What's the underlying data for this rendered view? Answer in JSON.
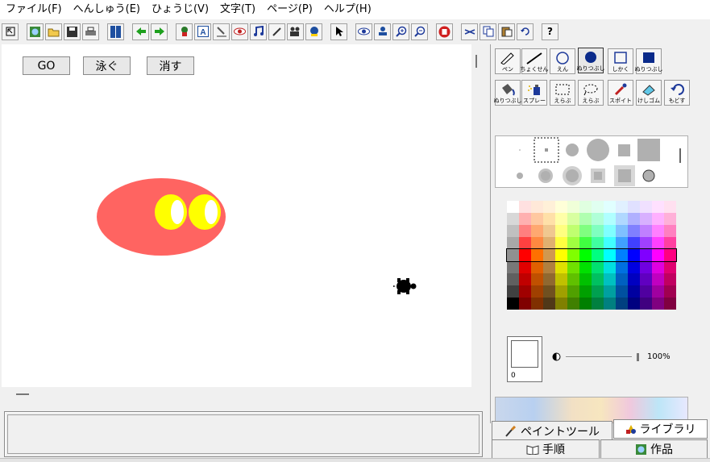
{
  "menu": [
    "ファイル(F)",
    "へんしゅう(E)",
    "ひょうじ(V)",
    "文字(T)",
    "ページ(P)",
    "ヘルプ(H)"
  ],
  "toolbar_icons": [
    "pointer-select-icon",
    "globe-icon",
    "open-folder-icon",
    "save-icon",
    "print-icon",
    "book-icon",
    "arrow-left-icon",
    "arrow-right-icon",
    "character-icon",
    "text-box-icon",
    "paint-tool-icon",
    "eye-icon",
    "music-icon",
    "pen-tool-icon",
    "camera-icon",
    "robot-icon",
    "arrow-cursor-icon",
    "view-eye-icon",
    "stamp-icon",
    "zoom-in-icon",
    "zoom-out-icon",
    "stop-hand-icon",
    "scissors-icon",
    "copy-icon",
    "paste-icon",
    "undo-icon",
    "help-icon"
  ],
  "help_label": "?",
  "canvas": {
    "buttons": [
      {
        "label": "GO"
      },
      {
        "label": "泳ぐ"
      },
      {
        "label": "消す"
      }
    ],
    "fish_color": "#ff6461",
    "eye_color": "#ffff00"
  },
  "paint_tools": {
    "row1": [
      "ペン",
      "ちょくせん",
      "えん",
      "ぬりつぶし",
      "しかく",
      "ぬりつぶし"
    ],
    "row2": [
      "ぬりつぶし",
      "スプレー",
      "えらぶ",
      "えらぶ",
      "スポイト",
      "けしゴム",
      "もどす"
    ]
  },
  "current_color": {
    "value": "0",
    "color": "#ffffff"
  },
  "opacity": {
    "label": "100%",
    "value": 100
  },
  "tabs": {
    "paint": "ペイントツール",
    "library": "ライブラリ",
    "steps": "手順",
    "works": "作品"
  },
  "palette_columns": [
    [
      "#ffffff",
      "#d8d8d8",
      "#c0c0c0",
      "#a8a8a8",
      "#909090",
      "#787878",
      "#606060",
      "#404040",
      "#000000"
    ],
    [
      "#ffe0e0",
      "#ffb0b0",
      "#ff8080",
      "#ff4040",
      "#ff0000",
      "#e00000",
      "#c00000",
      "#a00000",
      "#800000"
    ],
    [
      "#ffe8d8",
      "#ffc8a0",
      "#ffa870",
      "#ff8840",
      "#ff7000",
      "#e06000",
      "#c05000",
      "#a04000",
      "#803000"
    ],
    [
      "#fff0d8",
      "#ffe0a8",
      "#f0c890",
      "#e0b070",
      "#d09850",
      "#b08040",
      "#906830",
      "#705020",
      "#503818"
    ],
    [
      "#ffffd8",
      "#ffffa8",
      "#ffff80",
      "#ffff40",
      "#ffff00",
      "#e0e000",
      "#c0c000",
      "#a0a000",
      "#808000"
    ],
    [
      "#f0ffd8",
      "#d8ffa0",
      "#c0ff70",
      "#a0ff40",
      "#80ff00",
      "#70e000",
      "#60c000",
      "#50a000",
      "#408000"
    ],
    [
      "#e0ffe0",
      "#b0ffb0",
      "#80ff80",
      "#40ff40",
      "#00ff00",
      "#00e000",
      "#00c000",
      "#00a000",
      "#008000"
    ],
    [
      "#e0fff0",
      "#b0ffd8",
      "#80ffc0",
      "#40ffa0",
      "#00ff80",
      "#00e070",
      "#00c060",
      "#00a050",
      "#008040"
    ],
    [
      "#e0ffff",
      "#b0ffff",
      "#80ffff",
      "#40ffff",
      "#00ffff",
      "#00e0e0",
      "#00c0c0",
      "#00a0a0",
      "#008080"
    ],
    [
      "#e0f0ff",
      "#b0d8ff",
      "#80c0ff",
      "#40a0ff",
      "#0080ff",
      "#0070e0",
      "#0060c0",
      "#0050a0",
      "#004080"
    ],
    [
      "#e0e0ff",
      "#b0b0ff",
      "#8080ff",
      "#4040ff",
      "#0000ff",
      "#0000e0",
      "#0000c0",
      "#0000a0",
      "#000080"
    ],
    [
      "#f0e0ff",
      "#d8b0ff",
      "#c080ff",
      "#a040ff",
      "#8000ff",
      "#7000e0",
      "#6000c0",
      "#5000a0",
      "#400080"
    ],
    [
      "#ffe0ff",
      "#ffb0ff",
      "#ff80ff",
      "#ff40ff",
      "#ff00ff",
      "#e000e0",
      "#c000c0",
      "#a000a0",
      "#800080"
    ],
    [
      "#ffe0f0",
      "#ffb0d8",
      "#ff80c0",
      "#ff40a0",
      "#ff0080",
      "#e00070",
      "#c00060",
      "#a00050",
      "#800040"
    ]
  ],
  "selected_palette_row": 4
}
